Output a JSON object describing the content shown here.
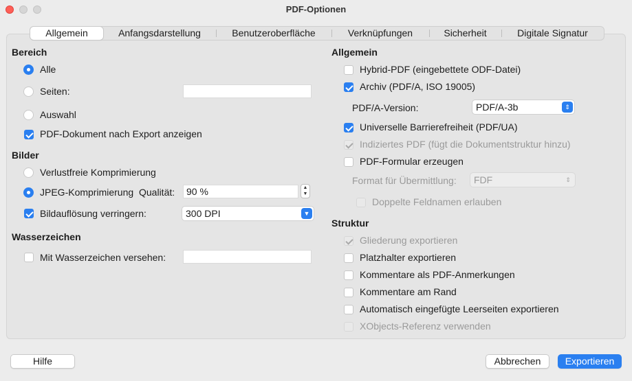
{
  "window": {
    "title": "PDF-Optionen"
  },
  "tabs": [
    {
      "label": "Allgemein",
      "active": true
    },
    {
      "label": "Anfangsdarstellung"
    },
    {
      "label": "Benutzeroberfläche"
    },
    {
      "label": "Verknüpfungen"
    },
    {
      "label": "Sicherheit"
    },
    {
      "label": "Digitale Signatur"
    }
  ],
  "left": {
    "range": {
      "header": "Bereich",
      "all_label": "Alle",
      "pages_label": "Seiten:",
      "pages_value": "",
      "selection_label": "Auswahl",
      "show_after_export_label": "PDF-Dokument nach Export anzeigen"
    },
    "images": {
      "header": "Bilder",
      "lossless_label": "Verlustfreie Komprimierung",
      "jpeg_label": "JPEG-Komprimierung",
      "quality_label": "Qualität:",
      "quality_value": "90 %",
      "reduce_label": "Bildauflösung verringern:",
      "resolution_value": "300 DPI"
    },
    "watermark": {
      "header": "Wasserzeichen",
      "sign_label": "Mit Wasserzeichen versehen:",
      "text_value": ""
    }
  },
  "right": {
    "general": {
      "header": "Allgemein",
      "hybrid_label": "Hybrid-PDF (eingebettete ODF-Datei)",
      "archive_label": "Archiv (PDF/A, ISO 19005)",
      "pdfa_version_label": "PDF/A-Version:",
      "pdfa_version_value": "PDF/A-3b",
      "ua_label": "Universelle Barrierefreiheit (PDF/UA)",
      "tagged_label": "Indiziertes PDF (fügt die Dokumentstruktur hinzu)",
      "form_label": "PDF-Formular erzeugen",
      "submit_format_label": "Format für Übermittlung:",
      "submit_format_value": "FDF",
      "duplicate_names_label": "Doppelte Feldnamen erlauben"
    },
    "structure": {
      "header": "Struktur",
      "outline_label": "Gliederung exportieren",
      "placeholders_label": "Platzhalter exportieren",
      "comments_label": "Kommentare als PDF-Anmerkungen",
      "margin_comments_label": "Kommentare am Rand",
      "blank_pages_label": "Automatisch eingefügte Leerseiten exportieren",
      "xobjects_label": "XObjects-Referenz verwenden"
    }
  },
  "buttons": {
    "help": "Hilfe",
    "cancel": "Abbrechen",
    "export": "Exportieren"
  },
  "colors": {
    "accent": "#2a7ff0",
    "close": "#fe5f57"
  }
}
